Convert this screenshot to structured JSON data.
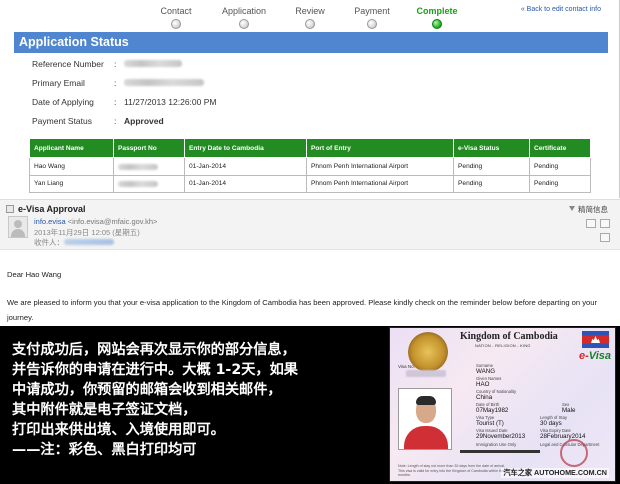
{
  "steps": [
    {
      "label": "Contact",
      "active": false
    },
    {
      "label": "Application",
      "active": false
    },
    {
      "label": "Review",
      "active": false
    },
    {
      "label": "Payment",
      "active": false
    },
    {
      "label": "Complete",
      "active": true
    }
  ],
  "back_link": "« Back to edit contact info",
  "app_status": {
    "title": "Application Status",
    "fields": {
      "reference_label": "Reference Number",
      "email_label": "Primary Email",
      "date_label": "Date of Applying",
      "date_value": "11/27/2013 12:26:00 PM",
      "payment_label": "Payment Status",
      "payment_value": "Approved",
      "separator": ":"
    }
  },
  "applicants_table": {
    "headers": [
      "Applicant Name",
      "Passport No",
      "Entry Date to Cambodia",
      "Port of Entry",
      "e-Visa Status",
      "Certificate"
    ],
    "rows": [
      {
        "name": "Hao Wang",
        "entry_date": "01-Jan-2014",
        "port": "Phnom Penh International Airport",
        "status": "Pending",
        "certificate": "Pending"
      },
      {
        "name": "Yan Liang",
        "entry_date": "01-Jan-2014",
        "port": "Phnom Penh International Airport",
        "status": "Pending",
        "certificate": "Pending"
      }
    ]
  },
  "email": {
    "subject": "e-Visa Approval",
    "view_detail": "精简信息",
    "sender_name": "info.evisa",
    "sender_addr": "<info.evisa@mfaic.gov.kh>",
    "date_line": "2013年11月29日 12:05 (星期五)",
    "recipient_label": "收件人：",
    "greeting": "Dear Hao Wang",
    "body": "We are pleased to inform you that your e-visa application to the Kingdom of Cambodia has been approved. Please kindly check on the reminder below before departing on your journey."
  },
  "caption_lines": [
    "支付成功后，网站会再次显示你的部分信息，",
    "并告诉你的申请在进行中。大概 1-2天，如果",
    "中请成功，你预留的邮箱会收到相关邮件，",
    "其中附件就是电子签证文档，",
    "打印出来供出境、入境使用即可。",
    "——注：彩色、黑白打印均可"
  ],
  "visa": {
    "title": "Kingdom of Cambodia",
    "subtitle": "NATION - RELIGION - KING",
    "evisa_e": "e-",
    "evisa_rest": "Visa",
    "visa_no_label": "Visa No.",
    "surname_label": "Surname",
    "surname": "WANG",
    "given_label": "Given Names",
    "given": "HAO",
    "nationality_label": "Country of Nationality",
    "nationality": "China",
    "dob_label": "Date of Birth",
    "dob": "07May1982",
    "sex_label": "Sex",
    "sex": "Male",
    "type_label": "Visa Type",
    "type": "Tourist (T)",
    "stay_label": "Length of Stay",
    "stay": "30 days",
    "issued_label": "Visa Issued Date",
    "issued": "29November2013",
    "expiry_label": "Visa Expiry Date",
    "expiry": "28February2014",
    "immigration_label": "Immigration Use Only",
    "legal_label": "Legal and Consular Department",
    "note": "Note: Length of stay not more than 30 days from the date of arrival. This visa is valid for entry into the Kingdom of Cambodia within three months."
  },
  "watermark": "汽车之家 AUTOHOME.COM.CN"
}
